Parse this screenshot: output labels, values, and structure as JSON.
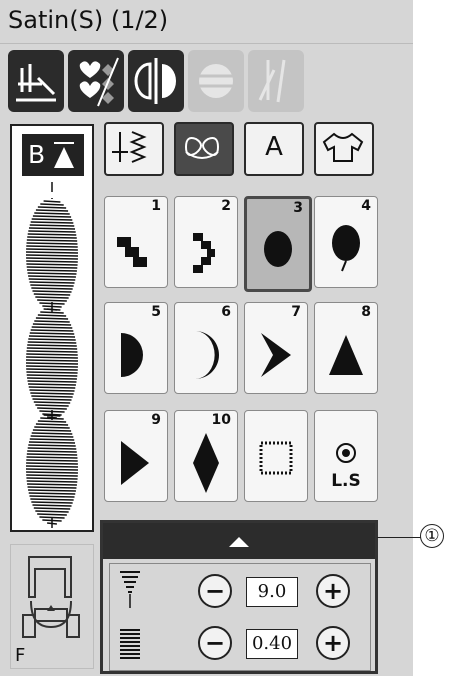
{
  "title": "Satin(S) (1/2)",
  "toolbar": {
    "buttons": [
      {
        "icon": "stitch-mode-icon",
        "enabled": true
      },
      {
        "icon": "heart-pattern-icon",
        "enabled": true
      },
      {
        "icon": "mirror-icon",
        "enabled": true
      },
      {
        "icon": "elongation-icon",
        "enabled": false
      },
      {
        "icon": "twin-needle-icon",
        "enabled": false
      }
    ]
  },
  "preview": {
    "badge": "B"
  },
  "presser_foot": {
    "label": "F"
  },
  "categories": [
    {
      "icon": "utility-stitch-icon",
      "text": ""
    },
    {
      "icon": "decorative-stitch-icon",
      "text": ""
    },
    {
      "icon": "letter-icon",
      "text": "A"
    },
    {
      "icon": "shirt-icon",
      "text": ""
    }
  ],
  "patterns": [
    {
      "num": "1",
      "icon": "step-bars-icon"
    },
    {
      "num": "2",
      "icon": "zigzag-bars-icon"
    },
    {
      "num": "3",
      "icon": "satin-oval-icon",
      "selected": true
    },
    {
      "num": "4",
      "icon": "satin-balloon-icon"
    },
    {
      "num": "5",
      "icon": "half-circle-icon"
    },
    {
      "num": "6",
      "icon": "crescent-icon"
    },
    {
      "num": "7",
      "icon": "chevron-icon"
    },
    {
      "num": "8",
      "icon": "triangle-icon"
    },
    {
      "num": "9",
      "icon": "right-triangle-icon"
    },
    {
      "num": "10",
      "icon": "diamond-icon"
    },
    {
      "num": "",
      "icon": "dotted-square-icon"
    },
    {
      "num": "",
      "icon": "lock-stitch-icon",
      "label": "L.S"
    }
  ],
  "controls": {
    "width": {
      "value": "9.0",
      "minus": "−",
      "plus": "+"
    },
    "density": {
      "value": "0.40",
      "minus": "−",
      "plus": "+"
    }
  },
  "callout": "①"
}
